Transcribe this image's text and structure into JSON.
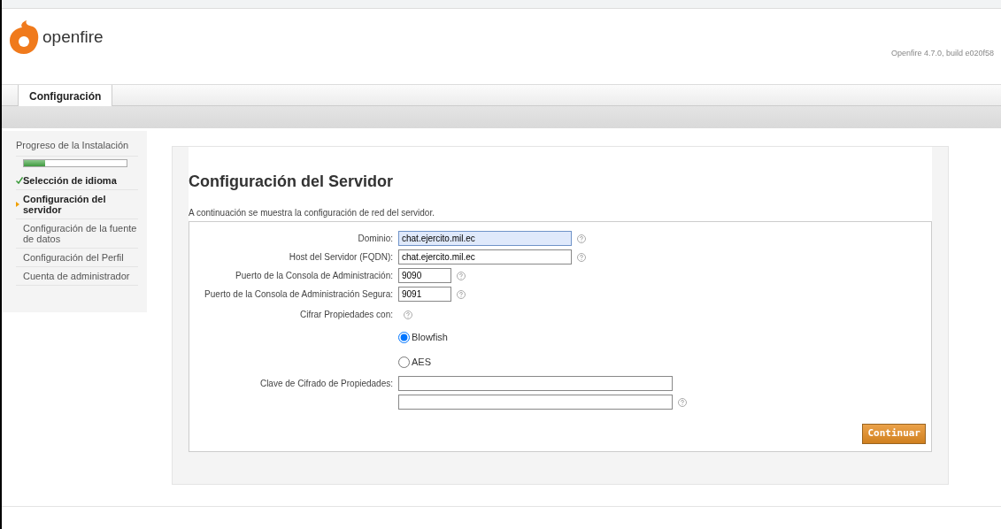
{
  "header": {
    "logo_text": "openfire",
    "version": "Openfire 4.7.0, build e020f58"
  },
  "tabs": [
    {
      "label": "Configuración",
      "selected": true
    }
  ],
  "sidebar": {
    "title": "Progreso de la Instalación",
    "progress": {
      "level": 0.21
    },
    "steps": [
      {
        "label": "Selección de idioma",
        "checked": true,
        "selected": false
      },
      {
        "label": "Configuración del servidor",
        "checked": false,
        "selected": true
      },
      {
        "label": "Configuración de la fuente de datos",
        "checked": false,
        "selected": false
      },
      {
        "label": "Configuración del Perfil",
        "checked": false,
        "selected": false
      },
      {
        "label": "Cuenta de administrador",
        "checked": false,
        "selected": false
      }
    ]
  },
  "main": {
    "title": "Configuración del Servidor",
    "description": "A continuación se muestra la configuración de red del servidor.",
    "fields": [
      {
        "kind": "text",
        "label": "Dominio:",
        "value": "chat.ejercito.mil.ec",
        "focused": true,
        "help": true
      },
      {
        "kind": "text",
        "label": "Host del Servidor (FQDN):",
        "value": "chat.ejercito.mil.ec",
        "focused": false,
        "help": true
      },
      {
        "kind": "port",
        "label": "Puerto de la Consola de Administración:",
        "value": "9090",
        "focused": false,
        "help": true
      },
      {
        "kind": "port",
        "label": "Puerto de la Consola de Administración Segura:",
        "value": "9091",
        "focused": false,
        "help": true
      },
      {
        "kind": "heading",
        "label": "Cifrar Propiedades con:",
        "help": true
      },
      {
        "kind": "radio",
        "label": "Blowfish",
        "selected": true
      },
      {
        "kind": "radio",
        "label": "AES",
        "selected": false
      },
      {
        "kind": "key",
        "label": "Clave de Cifrado de Propiedades:",
        "focused": false,
        "help": false
      },
      {
        "kind": "key",
        "focused": false,
        "help": true
      }
    ],
    "button": "Continuar"
  }
}
